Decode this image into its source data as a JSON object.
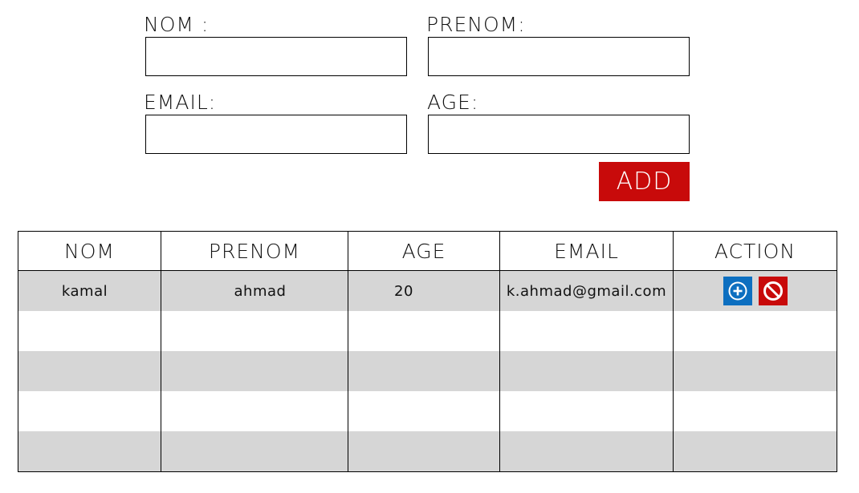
{
  "form": {
    "nom_label": "NOM :",
    "prenom_label": "PRENOM:",
    "email_label": "EMAIL:",
    "age_label": "AGE:",
    "nom_value": "",
    "prenom_value": "",
    "email_value": "",
    "age_value": "",
    "add_label": "ADD"
  },
  "table": {
    "headers": [
      "NOM",
      "PRENOM",
      "AGE",
      "EMAIL",
      "ACTION"
    ],
    "rows": [
      {
        "nom": "kamal",
        "prenom": "ahmad",
        "age": "20",
        "email": "k.ahmad@gmail.com"
      },
      {
        "nom": "",
        "prenom": "",
        "age": "",
        "email": ""
      },
      {
        "nom": "",
        "prenom": "",
        "age": "",
        "email": ""
      },
      {
        "nom": "",
        "prenom": "",
        "age": "",
        "email": ""
      },
      {
        "nom": "",
        "prenom": "",
        "age": "",
        "email": ""
      }
    ],
    "action_icons": [
      "plus-circle-icon",
      "block-icon"
    ]
  },
  "colors": {
    "accent_red": "#c80a0a",
    "accent_blue": "#0d6fc0",
    "row_stripe": "#d6d6d6"
  }
}
